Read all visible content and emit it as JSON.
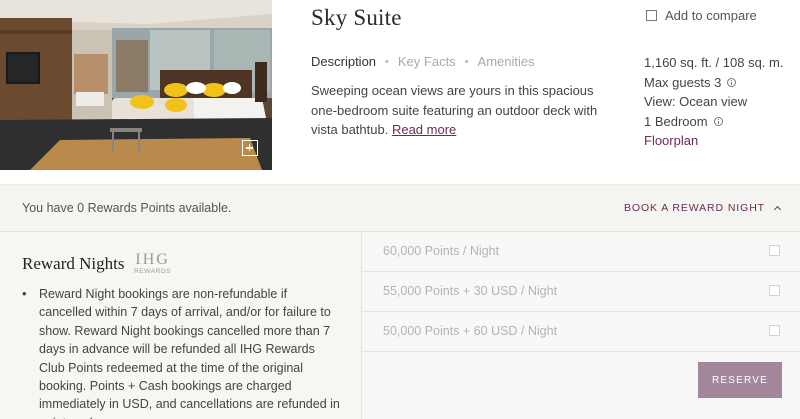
{
  "room": {
    "title": "Sky Suite",
    "tabs": [
      {
        "label": "Description",
        "active": true
      },
      {
        "label": "Key Facts",
        "active": false
      },
      {
        "label": "Amenities",
        "active": false
      }
    ],
    "description": "Sweeping ocean views are yours in this spacious one-bedroom suite featuring an outdoor deck with vista bathtub.",
    "read_more": "Read more",
    "compare_label": "Add to compare",
    "facts": {
      "size": "1,160 sq. ft. / 108 sq. m.",
      "guests": "Max guests 3",
      "view": "View: Ocean view",
      "bedrooms": "1 Bedroom",
      "floorplan": "Floorplan"
    }
  },
  "rewards": {
    "points_text": "You have 0 Rewards Points available.",
    "book_label": "BOOK A REWARD NIGHT",
    "title": "Reward Nights",
    "logo_main": "IHG",
    "logo_sub": "REWARDS",
    "policy": "Reward Night bookings are non-refundable if cancelled within 7 days of arrival, and/or for failure to show. Reward Night bookings cancelled more than 7 days in advance will be refunded all IHG Rewards Club Points redeemed at the time of the original booking. Points + Cash bookings are charged immediately in USD, and cancellations are refunded in points only",
    "options": [
      {
        "label": "60,000 Points / Night"
      },
      {
        "label": "55,000 Points + 30 USD / Night"
      },
      {
        "label": "50,000 Points + 60 USD / Night"
      }
    ],
    "reserve_label": "RESERVE"
  },
  "colors": {
    "accent": "#6b2b57",
    "reserve_bg": "#a4879c",
    "panel_bg": "#f4f4f0"
  }
}
